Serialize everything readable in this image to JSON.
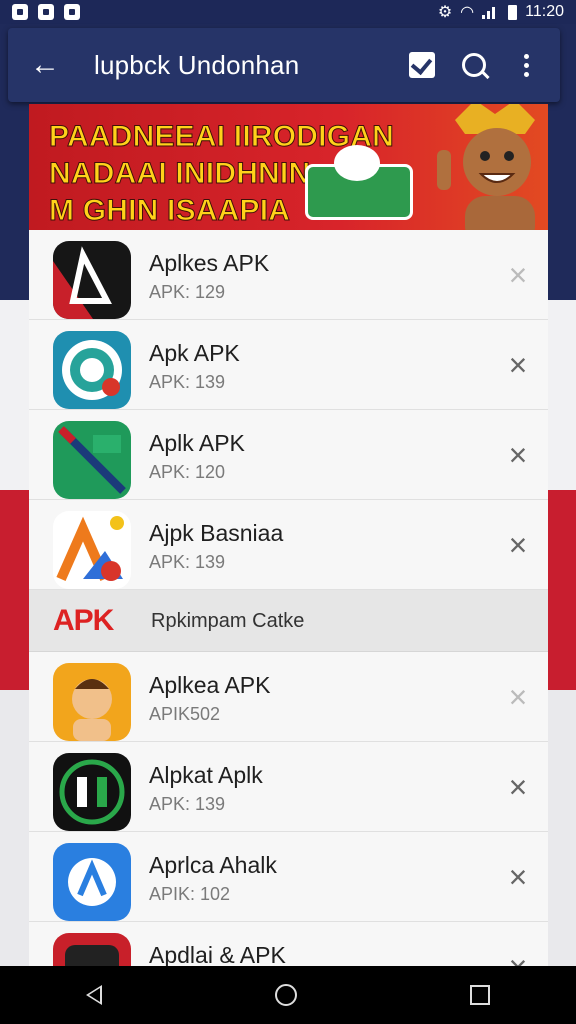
{
  "status_bar": {
    "time": "11:20"
  },
  "app_bar": {
    "title": "lupbck Undonhan"
  },
  "banner": {
    "lines": [
      "PAADNEEAI IIRODIGAN",
      "NADAAI INIDHNIN",
      "M GHIN ISAAPIA"
    ]
  },
  "apps_top": [
    {
      "name": "Aplkes APK",
      "version": "APK: 129",
      "remove": "×"
    },
    {
      "name": "Apk APK",
      "version": "APK: 139",
      "remove": "×"
    },
    {
      "name": "Aplk APK",
      "version": "APK: 120",
      "remove": "×"
    },
    {
      "name": "Ajpk Basniaa",
      "version": "APK: 139",
      "remove": "×"
    }
  ],
  "section": {
    "logo": "APK",
    "label": "Rpkimpam Catke"
  },
  "apps_bottom": [
    {
      "name": "Aplkea APK",
      "version": "APIK502",
      "remove": "×"
    },
    {
      "name": "Alpkat Aplk",
      "version": "APK: 139",
      "remove": "×"
    },
    {
      "name": "Aprlca Ahalk",
      "version": "APIK: 102",
      "remove": "×"
    },
    {
      "name": "Apdlai & APK",
      "version": "",
      "remove": "×"
    }
  ],
  "colors": {
    "app_bar": "#263468",
    "banner": "#c01a20",
    "banner_text": "#ffd21a"
  }
}
